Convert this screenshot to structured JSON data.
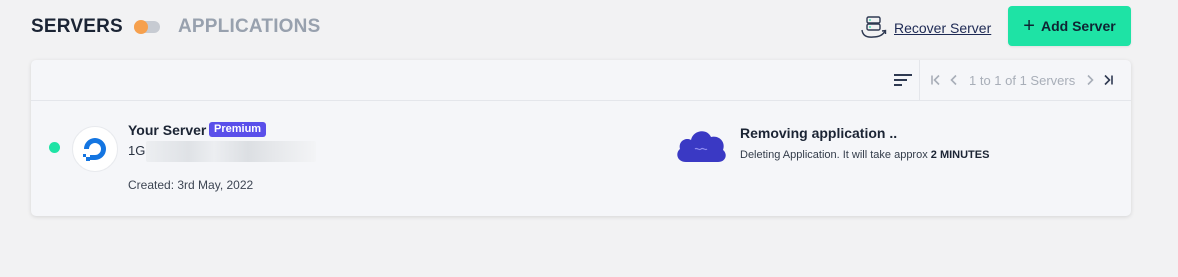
{
  "tabs": {
    "servers": "SERVERS",
    "applications": "APPLICATIONS"
  },
  "toggle": {
    "state": "servers",
    "accent": "#f6a04d"
  },
  "actions": {
    "recover_label": "Recover Server",
    "add_label": "Add Server",
    "add_color": "#1ee3a5"
  },
  "pagination": {
    "summary": "1 to 1 of 1 Servers"
  },
  "server": {
    "name": "Your Server",
    "badge": "Premium",
    "badge_color": "#5a4fea",
    "spec_prefix": "1GE",
    "created": "Created: 3rd May, 2022",
    "status_color": "#1ee3a5",
    "provider_icon": "digitalocean-icon"
  },
  "task": {
    "title": "Removing application ..",
    "desc_prefix": "Deleting Application. It will take approx ",
    "desc_duration": "2 MINUTES",
    "icon": "cloud-icon"
  }
}
